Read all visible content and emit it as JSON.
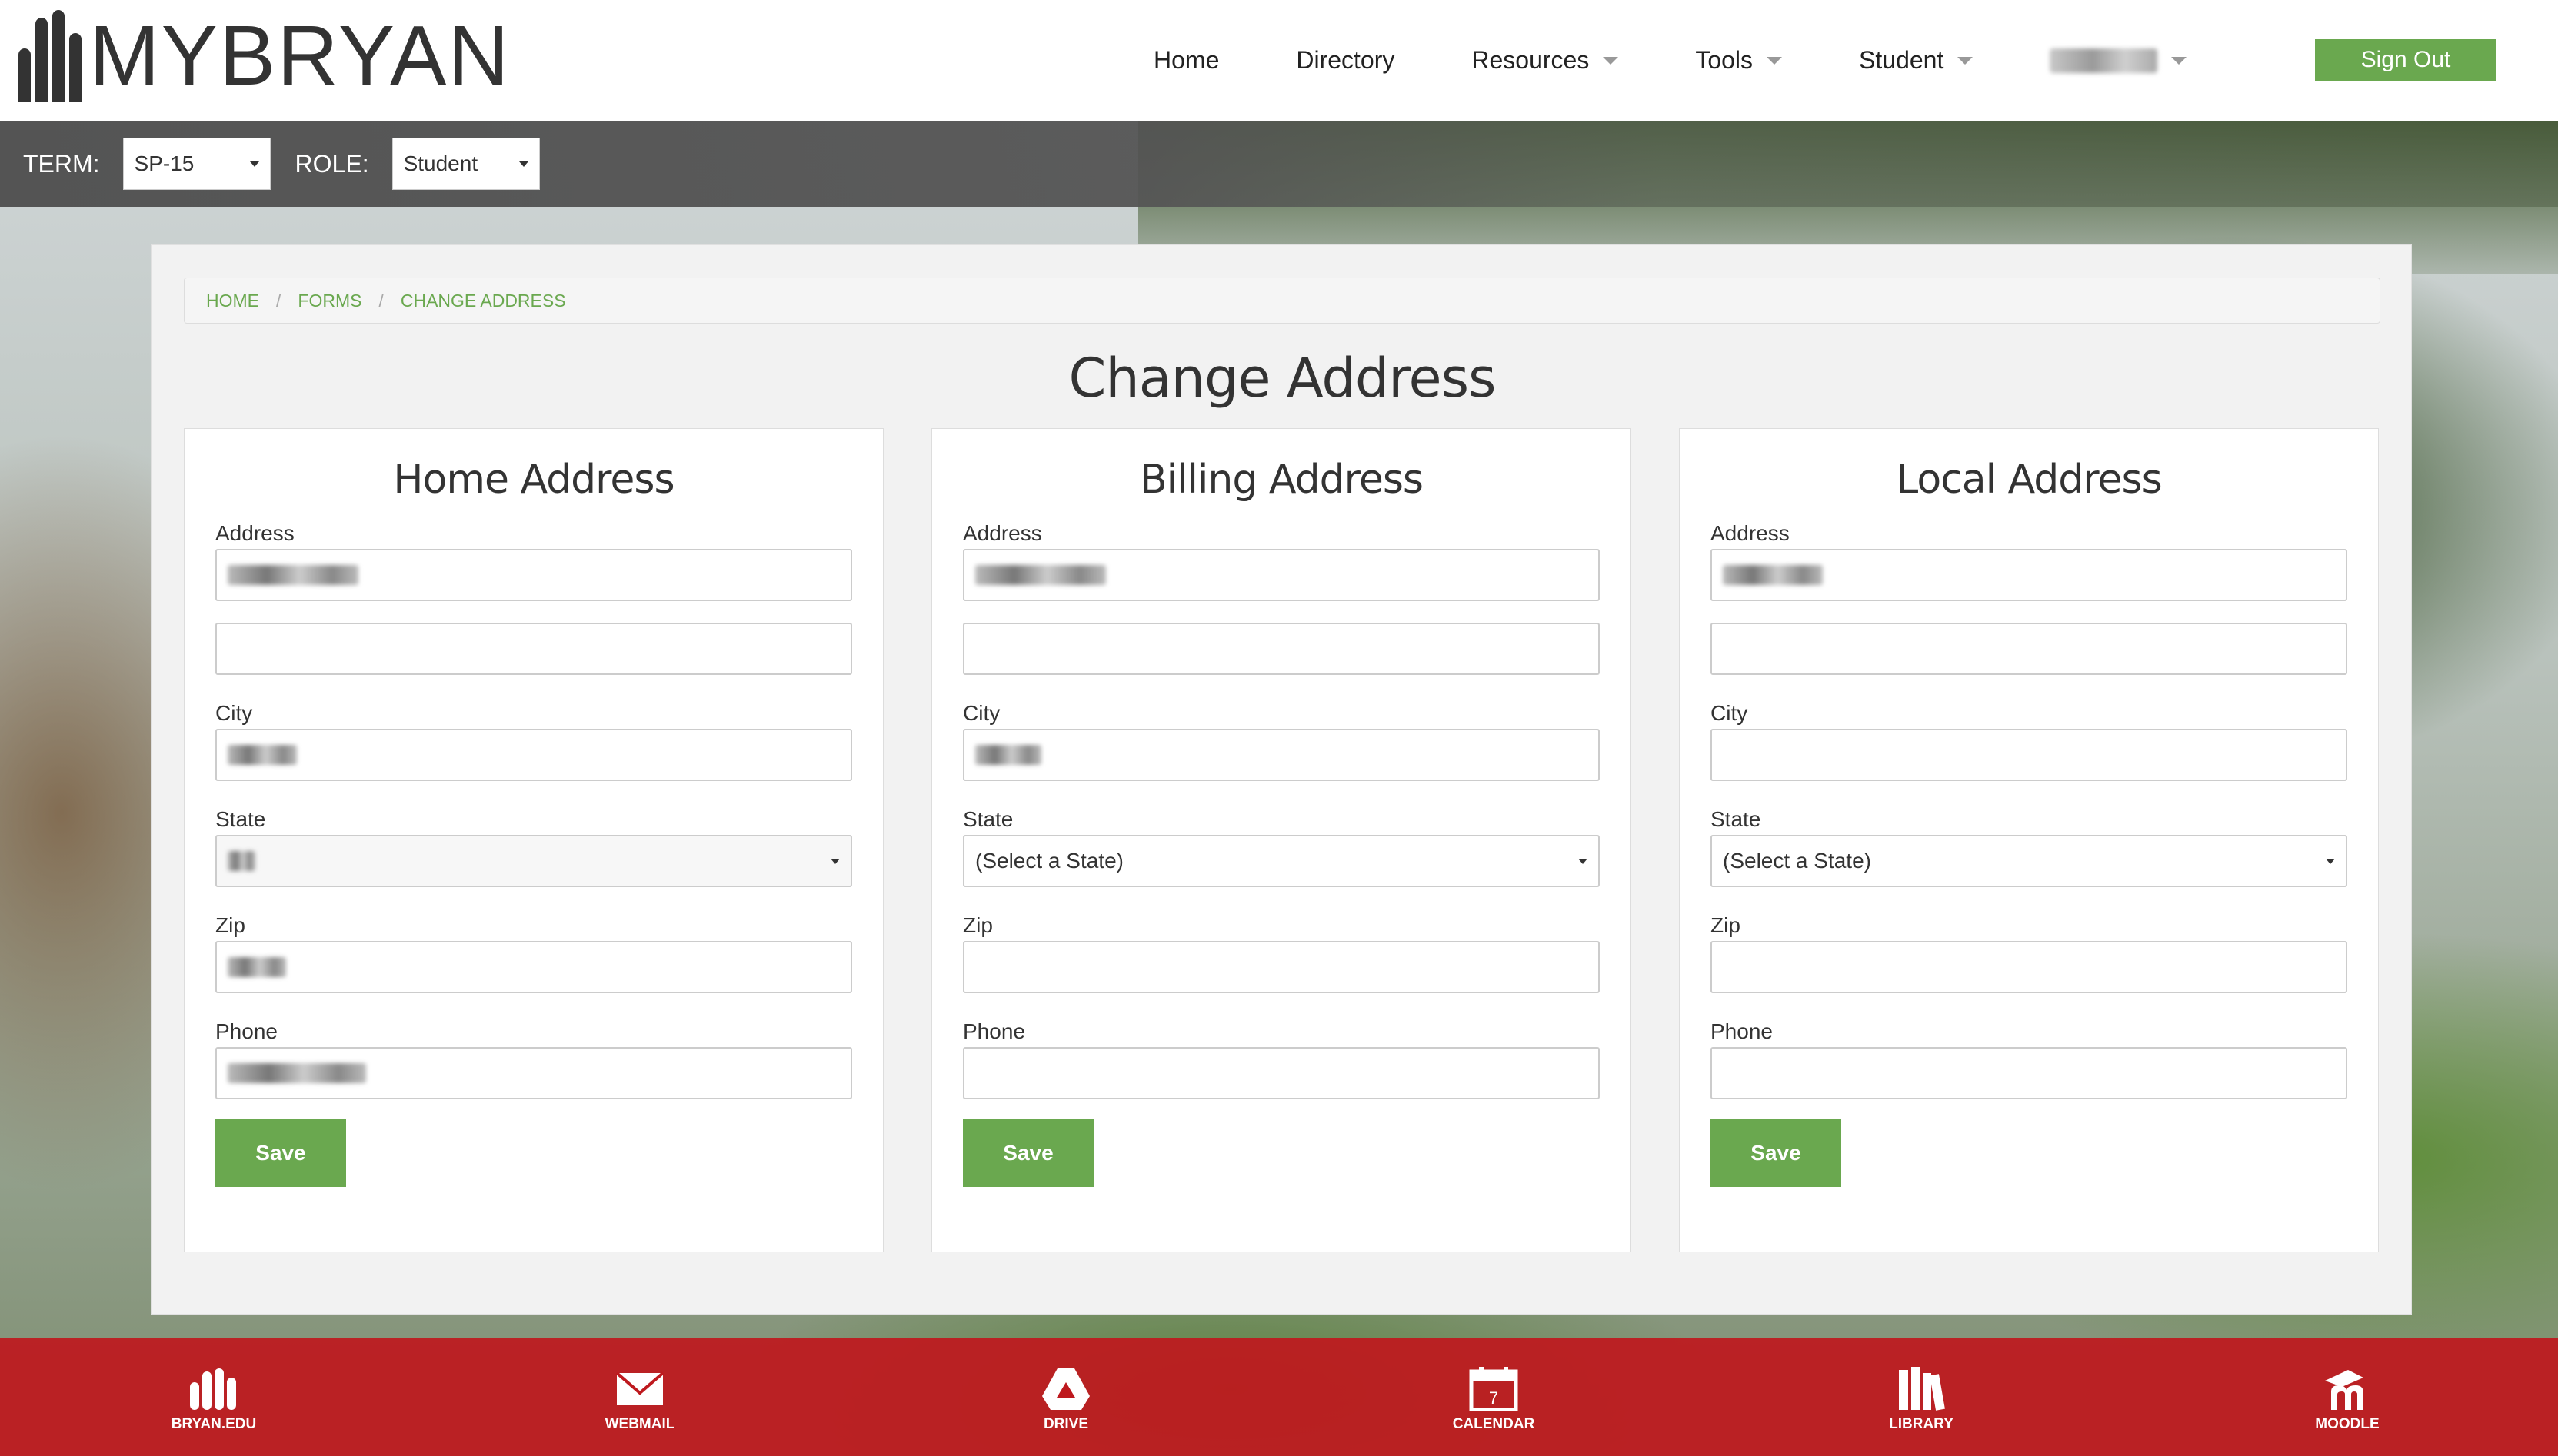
{
  "header": {
    "logo_text": "MYBRYAN",
    "nav": [
      {
        "label": "Home"
      },
      {
        "label": "Directory"
      },
      {
        "label": "Resources"
      },
      {
        "label": "Tools"
      },
      {
        "label": "Student"
      }
    ],
    "sign_out": "Sign Out"
  },
  "termbar": {
    "term_label": "TERM:",
    "term_value": "SP-15",
    "role_label": "ROLE:",
    "role_value": "Student"
  },
  "breadcrumb": [
    "HOME",
    "FORMS",
    "CHANGE ADDRESS"
  ],
  "page_title": "Change Address",
  "labels": {
    "address": "Address",
    "city": "City",
    "state": "State",
    "zip": "Zip",
    "phone": "Phone",
    "save": "Save"
  },
  "cards": [
    {
      "title": "Home Address",
      "state_value": ""
    },
    {
      "title": "Billing Address",
      "state_value": "(Select a State)"
    },
    {
      "title": "Local Address",
      "state_value": "(Select a State)"
    }
  ],
  "footer": [
    {
      "label": "BRYAN.EDU",
      "icon": "college-icon"
    },
    {
      "label": "WEBMAIL",
      "icon": "mail-icon"
    },
    {
      "label": "DRIVE",
      "icon": "drive-icon"
    },
    {
      "label": "CALENDAR",
      "icon": "calendar-icon",
      "day": "7"
    },
    {
      "label": "LIBRARY",
      "icon": "books-icon"
    },
    {
      "label": "MOODLE",
      "icon": "moodle-icon"
    }
  ],
  "colors": {
    "accent_green": "#6aa84f",
    "footer_red": "#be191e",
    "term_bar": "#555555"
  }
}
